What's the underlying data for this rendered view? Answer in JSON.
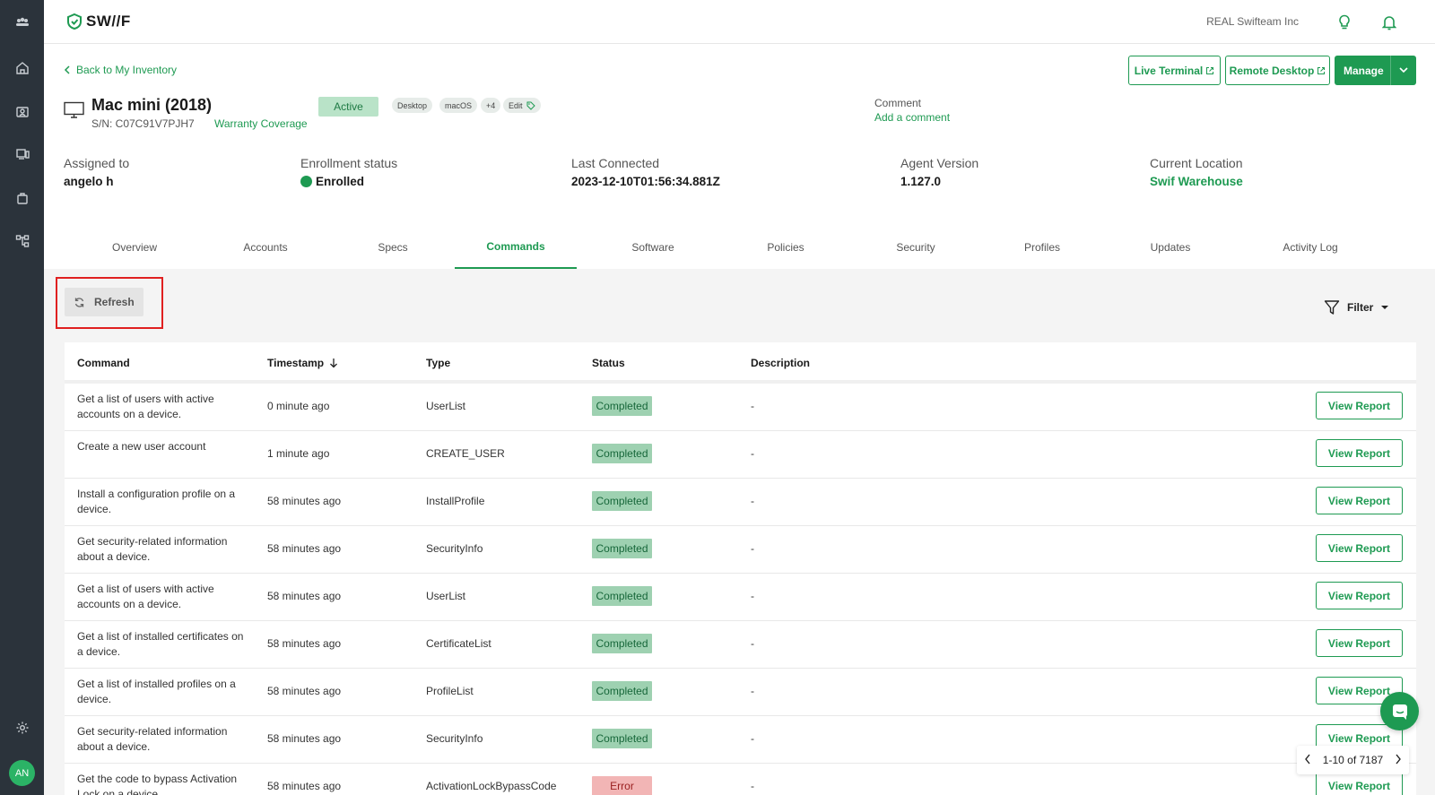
{
  "app": {
    "logo_text": "SW//F",
    "org_name": "REAL Swifteam Inc",
    "accent": "#1e9a52"
  },
  "sidebar": {
    "items": [
      {
        "icon": "team-icon"
      },
      {
        "icon": "home-icon"
      },
      {
        "icon": "people-icon"
      },
      {
        "icon": "devices-icon"
      },
      {
        "icon": "inventory-icon"
      },
      {
        "icon": "workflow-icon"
      },
      {
        "icon": "settings-icon"
      }
    ],
    "avatar_initials": "AN"
  },
  "header": {
    "back_label": "Back to My Inventory"
  },
  "actions": {
    "live_terminal": "Live Terminal",
    "remote_desktop": "Remote Desktop",
    "manage": "Manage"
  },
  "device": {
    "name": "Mac mini (2018)",
    "serial": "S/N: C07C91V7PJH7",
    "warranty": "Warranty Coverage",
    "status": "Active",
    "tags": [
      "Desktop",
      "macOS",
      "+4"
    ],
    "edit_tag_label": "Edit",
    "comment_label": "Comment",
    "comment_link": "Add a comment"
  },
  "meta": {
    "assigned_label": "Assigned to",
    "assigned_value": "angelo h",
    "enroll_label": "Enrollment status",
    "enroll_value": "Enrolled",
    "last_label": "Last Connected",
    "last_value": "2023-12-10T01:56:34.881Z",
    "agent_label": "Agent Version",
    "agent_value": "1.127.0",
    "location_label": "Current Location",
    "location_value": "Swif Warehouse"
  },
  "tabs": [
    "Overview",
    "Accounts",
    "Specs",
    "Commands",
    "Software",
    "Policies",
    "Security",
    "Profiles",
    "Updates",
    "Activity Log"
  ],
  "active_tab": "Commands",
  "toolbar": {
    "refresh": "Refresh",
    "filter": "Filter"
  },
  "table": {
    "headers": {
      "command": "Command",
      "timestamp": "Timestamp",
      "type": "Type",
      "status": "Status",
      "description": "Description"
    },
    "rows": [
      {
        "command": "Get a list of users with active accounts on a device.",
        "timestamp": "0 minute ago",
        "type": "UserList",
        "status": "Completed",
        "description": "-",
        "action": "View Report"
      },
      {
        "command": "Create a new user account",
        "timestamp": "1 minute ago",
        "type": "CREATE_USER",
        "status": "Completed",
        "description": "-",
        "action": "View Report"
      },
      {
        "command": "Install a configuration profile on a device.",
        "timestamp": "58 minutes ago",
        "type": "InstallProfile",
        "status": "Completed",
        "description": "-",
        "action": "View Report"
      },
      {
        "command": "Get security-related information about a device.",
        "timestamp": "58 minutes ago",
        "type": "SecurityInfo",
        "status": "Completed",
        "description": "-",
        "action": "View Report"
      },
      {
        "command": "Get a list of users with active accounts on a device.",
        "timestamp": "58 minutes ago",
        "type": "UserList",
        "status": "Completed",
        "description": "-",
        "action": "View Report"
      },
      {
        "command": "Get a list of installed certificates on a device.",
        "timestamp": "58 minutes ago",
        "type": "CertificateList",
        "status": "Completed",
        "description": "-",
        "action": "View Report"
      },
      {
        "command": "Get a list of installed profiles on a device.",
        "timestamp": "58 minutes ago",
        "type": "ProfileList",
        "status": "Completed",
        "description": "-",
        "action": "View Report"
      },
      {
        "command": "Get security-related information about a device.",
        "timestamp": "58 minutes ago",
        "type": "SecurityInfo",
        "status": "Completed",
        "description": "-",
        "action": "View Report"
      },
      {
        "command": "Get the code to bypass Activation Lock on a device.",
        "timestamp": "58 minutes ago",
        "type": "ActivationLockBypassCode",
        "status": "Error",
        "description": "-",
        "action": "View Report"
      }
    ]
  },
  "pagination": {
    "label": "1-10 of 7187"
  }
}
